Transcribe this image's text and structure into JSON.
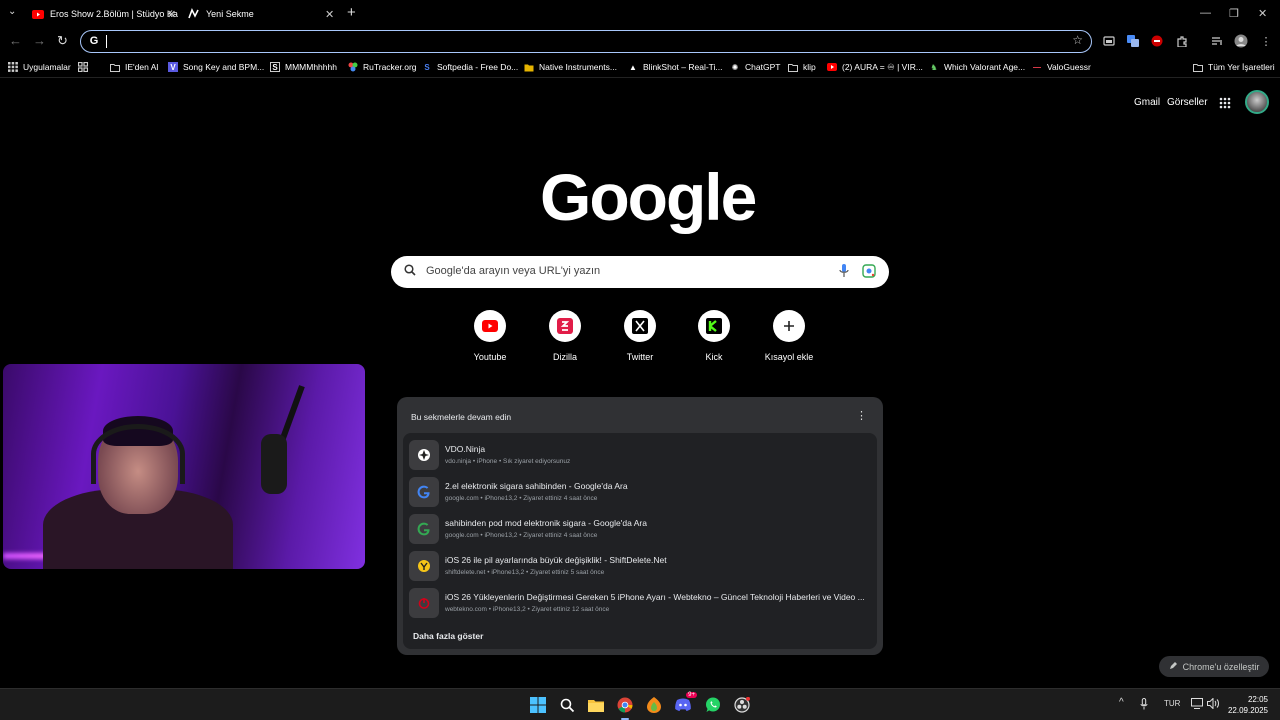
{
  "tabs": [
    {
      "title": "Eros Show 2.Bölüm | Stüdyo Ka",
      "favicon": "youtube-icon"
    },
    {
      "title": "Yeni Sekme",
      "favicon": "new-tab-icon"
    }
  ],
  "bookmarks": [
    {
      "label": "Uygulamalar",
      "icon": "apps-icon"
    },
    {
      "label": "IE'den Al",
      "icon": "folder-icon"
    },
    {
      "label": "Song Key and BPM...",
      "icon": "v-icon"
    },
    {
      "label": "MMMMhhhhh",
      "icon": "s-icon"
    },
    {
      "label": "RuTracker.org",
      "icon": "rutracker-icon"
    },
    {
      "label": "Softpedia - Free Do...",
      "icon": "softpedia-icon"
    },
    {
      "label": "Native Instruments...",
      "icon": "folder-icon"
    },
    {
      "label": "BlinkShot – Real-Ti...",
      "icon": "triangle-icon"
    },
    {
      "label": "ChatGPT",
      "icon": "chatgpt-icon"
    },
    {
      "label": "klip",
      "icon": "folder-icon"
    },
    {
      "label": "(2) AURA = ♾ | VIR...",
      "icon": "youtube-icon"
    },
    {
      "label": "Which Valorant Age...",
      "icon": "valorant-icon"
    },
    {
      "label": "ValoGuessr",
      "icon": "valoguessr-icon"
    },
    {
      "label": "Tüm Yer İşaretleri",
      "icon": "folder-icon"
    }
  ],
  "header": {
    "gmail": "Gmail",
    "images": "Görseller"
  },
  "logo": "Google",
  "search": {
    "placeholder": "Google'da arayın veya URL'yi yazın"
  },
  "shortcuts": [
    {
      "label": "Youtube",
      "icon": "youtube-icon",
      "color": "#ff0000"
    },
    {
      "label": "Dizilla",
      "icon": "dizilla-icon",
      "color": "#e11d48"
    },
    {
      "label": "Twitter",
      "icon": "x-icon",
      "color": "#000000"
    },
    {
      "label": "Kick",
      "icon": "kick-icon",
      "color": "#53fc18"
    },
    {
      "label": "Kısayol ekle",
      "icon": "plus-icon",
      "color": "#000000"
    }
  ],
  "resume": {
    "heading": "Bu sekmelerle devam edin",
    "items": [
      {
        "title": "VDO.Ninja",
        "sub": "vdo.ninja • iPhone • Sık ziyaret ediyorsunuz",
        "icon": "vdo-ninja-icon"
      },
      {
        "title": "2.el elektronik sigara sahibinden - Google'da Ara",
        "sub": "google.com • iPhone13,2 • Ziyaret ettiniz 4 saat önce",
        "icon": "google-icon"
      },
      {
        "title": "sahibinden pod mod elektronik sigara - Google'da Ara",
        "sub": "google.com • iPhone13,2 • Ziyaret ettiniz 4 saat önce",
        "icon": "google-icon"
      },
      {
        "title": "iOS 26 ile pil ayarlarında büyük değişiklik! - ShiftDelete.Net",
        "sub": "shiftdelete.net • iPhone13,2 • Ziyaret ettiniz 5 saat önce",
        "icon": "shiftdelete-icon"
      },
      {
        "title": "iOS 26 Yükleyenlerin Değiştirmesi Gereken 5 iPhone Ayarı - Webtekno – Güncel Teknoloji Haberleri ve Video ...",
        "sub": "webtekno.com • iPhone13,2 • Ziyaret ettiniz 12 saat önce",
        "icon": "webtekno-icon"
      }
    ],
    "more": "Daha fazla göster"
  },
  "customize": "Chrome'u özelleştir",
  "taskbar": {
    "lang": "TUR",
    "time": "22:05",
    "date": "22.09.2025",
    "discord_badge": "9+"
  }
}
